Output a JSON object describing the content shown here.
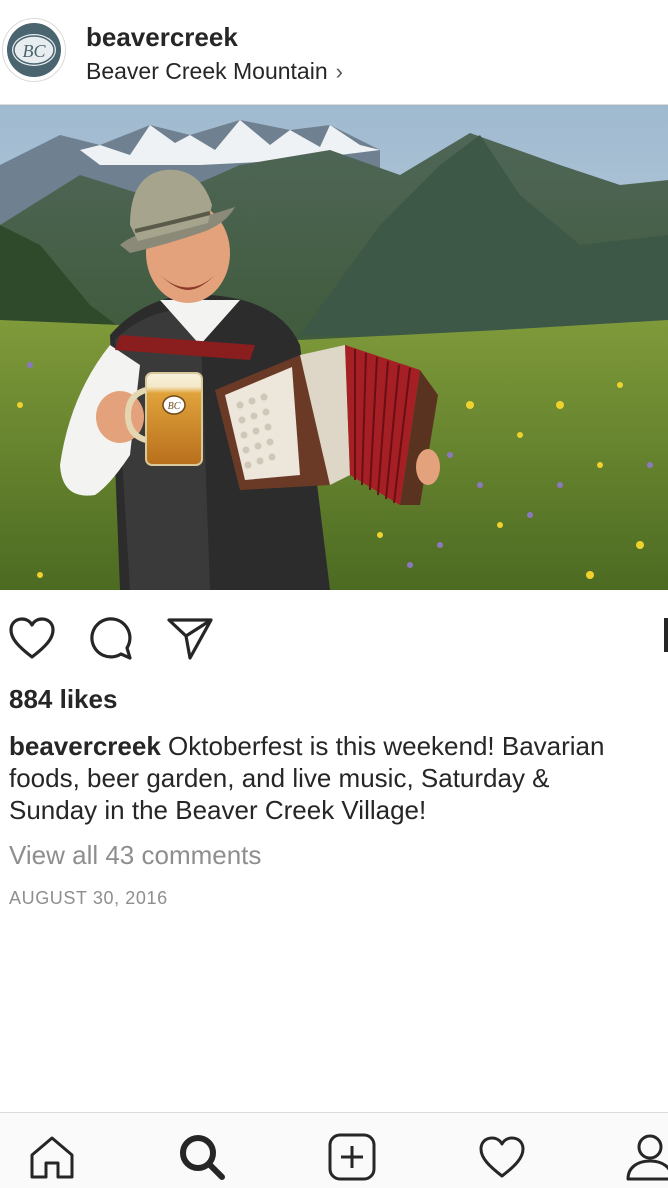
{
  "header": {
    "username": "beavercreek",
    "location": "Beaver Creek Mountain",
    "location_chevron": "›",
    "avatar_text": "BC"
  },
  "photo": {
    "mug_text": "BC"
  },
  "post": {
    "likes": "884 likes",
    "caption_user": "beavercreek",
    "caption_text": " Oktoberfest is this weekend! Bavarian\nfoods, beer garden, and live music, Saturday &\nSunday in the Beaver Creek Village!",
    "view_comments": "View all 43 comments",
    "date": "AUGUST 30, 2016"
  },
  "actions": [
    "heart-icon",
    "comment-icon",
    "share-icon",
    "bookmark-icon"
  ],
  "tabs": [
    "home-icon",
    "search-icon",
    "add-icon",
    "activity-icon",
    "profile-icon"
  ],
  "colors": {
    "text": "#262626",
    "muted": "#8e8e8e",
    "divider": "#dbdbdb",
    "tabbar": "#fafafa"
  }
}
